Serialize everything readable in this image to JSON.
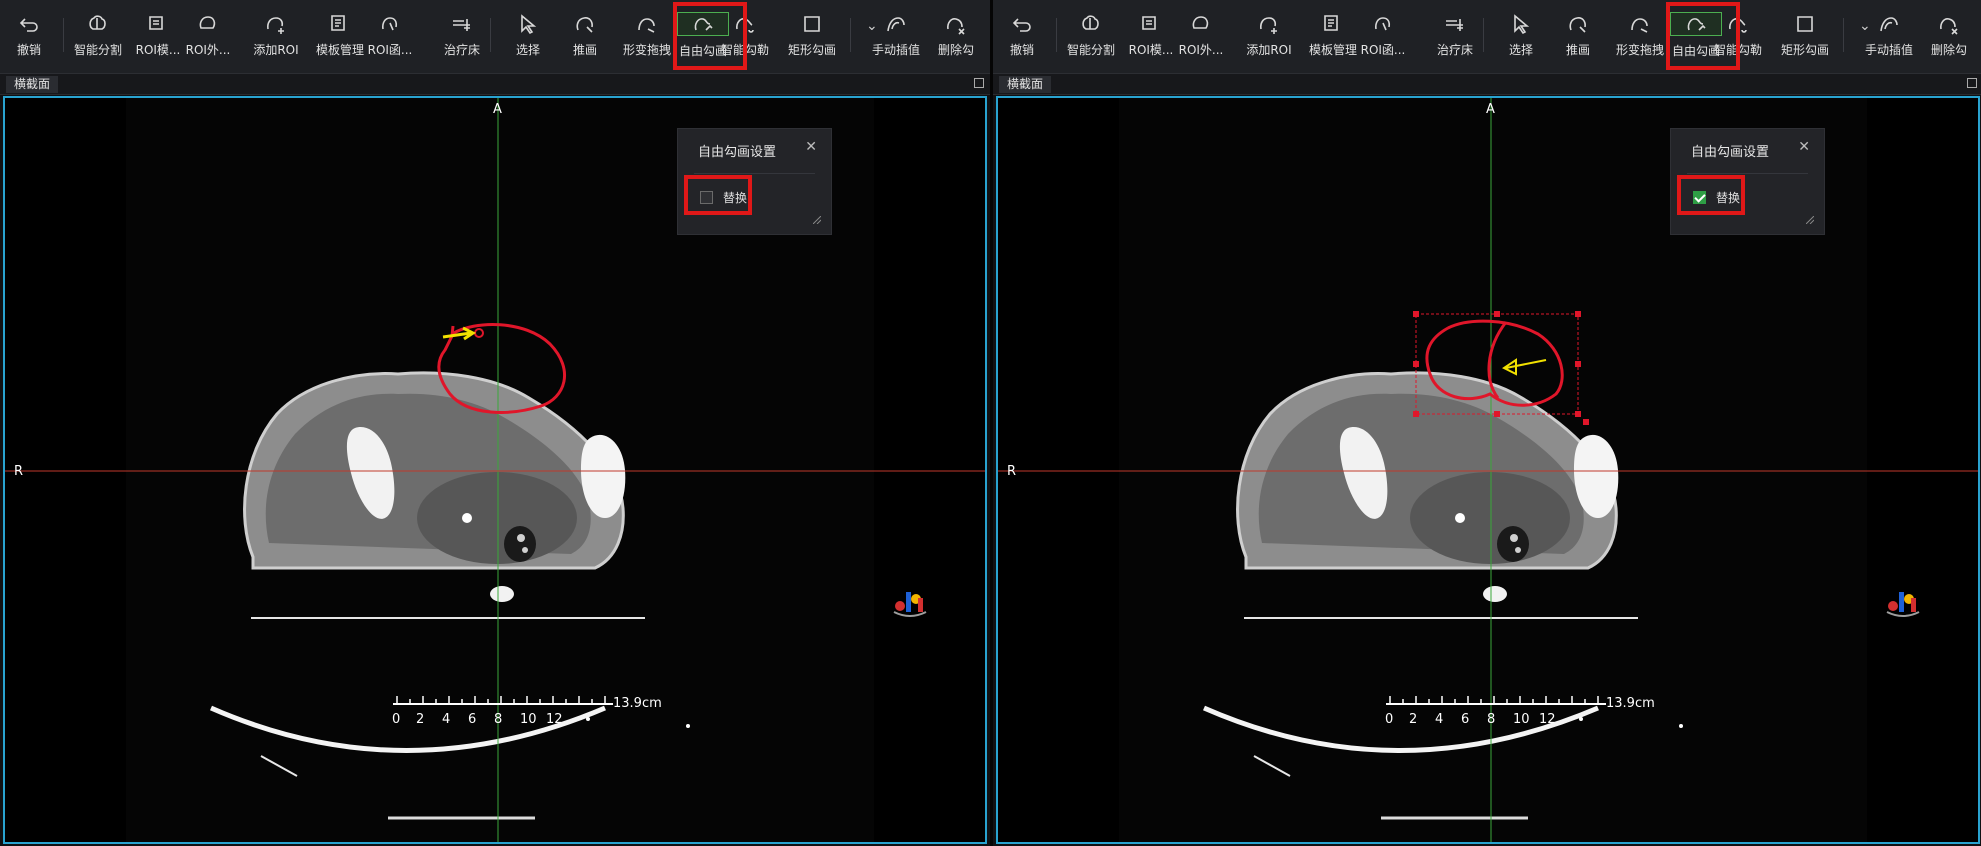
{
  "toolbar": {
    "tools": [
      {
        "key": "undo",
        "label": "撤销",
        "icon": "undo-icon"
      },
      {
        "key": "smart-segment",
        "label": "智能分割",
        "icon": "brain-icon"
      },
      {
        "key": "roi-model",
        "label": "ROI模...",
        "icon": "roi-model-icon"
      },
      {
        "key": "roi-outer",
        "label": "ROI外...",
        "icon": "roi-outer-icon"
      },
      {
        "key": "add-roi",
        "label": "添加ROI",
        "icon": "add-roi-icon"
      },
      {
        "key": "template-manage",
        "label": "模板管理",
        "icon": "template-icon"
      },
      {
        "key": "roi-function",
        "label": "ROI函...",
        "icon": "roi-function-icon"
      },
      {
        "key": "couch",
        "label": "治疗床",
        "icon": "couch-icon"
      },
      {
        "key": "select",
        "label": "选择",
        "icon": "cursor-icon"
      },
      {
        "key": "push",
        "label": "推画",
        "icon": "push-draw-icon"
      },
      {
        "key": "deform-drag",
        "label": "形变拖拽",
        "icon": "deform-drag-icon"
      },
      {
        "key": "free-draw",
        "label": "自由勾画",
        "icon": "free-draw-icon",
        "active": true
      },
      {
        "key": "smart-outline",
        "label": "智能勾勒",
        "icon": "smart-outline-icon"
      },
      {
        "key": "rect-draw",
        "label": "矩形勾画",
        "icon": "rectangle-icon"
      },
      {
        "key": "manual-interp",
        "label": "手动插值",
        "icon": "interpolation-icon"
      },
      {
        "key": "delete",
        "label": "删除勾",
        "icon": "delete-contour-icon"
      }
    ]
  },
  "tab": {
    "label": "横截面"
  },
  "orientation": {
    "top": "A",
    "left": "R"
  },
  "scale": {
    "unit_label": "13.9cm",
    "ticks": [
      "0",
      "2",
      "4",
      "6",
      "8",
      "10",
      "12"
    ]
  },
  "dialog": {
    "title": "自由勾画设置",
    "checkbox_label": "替换",
    "left_checked": false,
    "right_checked": true
  },
  "colors": {
    "accent_blue": "#29a3d0",
    "highlight_red": "#e01818",
    "contour_red": "#e0162a",
    "crosshair_green": "#3aa83a",
    "crosshair_red": "#c0392b",
    "arrow_yellow": "#f2e100",
    "check_green": "#2e9e45"
  }
}
